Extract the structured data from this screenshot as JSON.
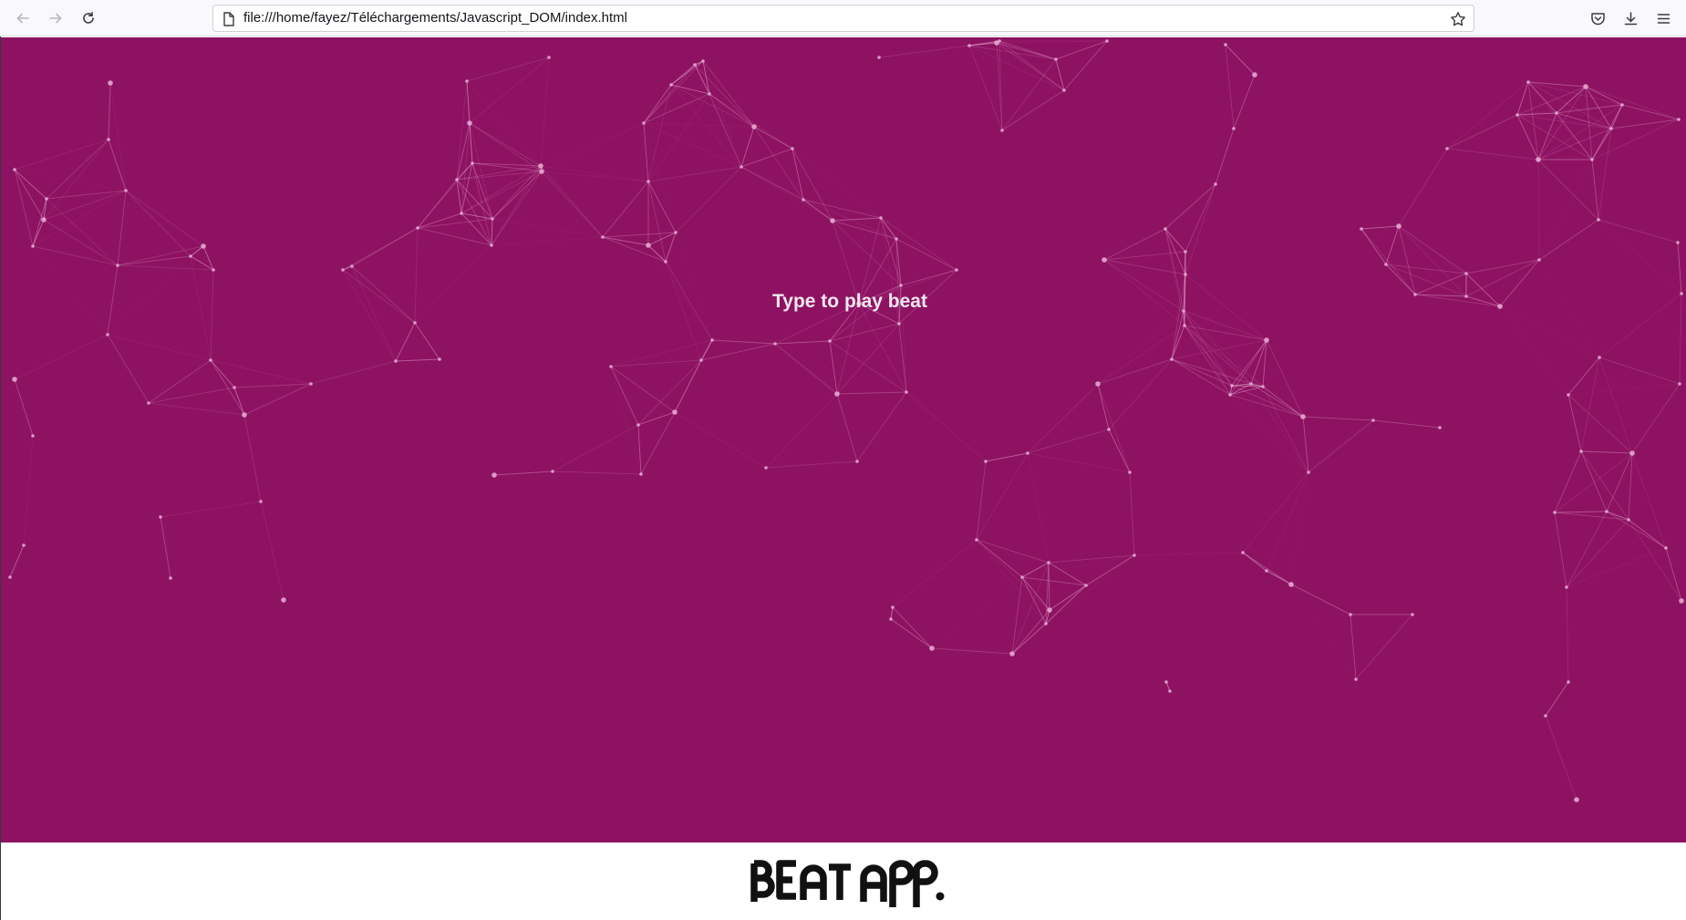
{
  "browser": {
    "url": "file:///home/fayez/Téléchargements/Javascript_DOM/index.html",
    "icons": {
      "back": "arrow-left-icon",
      "forward": "arrow-right-icon",
      "reload": "reload-icon",
      "page": "page-icon",
      "bookmark": "star-icon",
      "pocket": "pocket-icon",
      "downloads": "download-icon",
      "menu": "hamburger-menu-icon"
    }
  },
  "page": {
    "prompt": "Type to play beat",
    "logo_text": "BEAT APP.",
    "colors": {
      "background": "#8e1262",
      "particles": "#e6a6cf",
      "prompt": "#f1e6ee",
      "logo": "#111111"
    }
  }
}
